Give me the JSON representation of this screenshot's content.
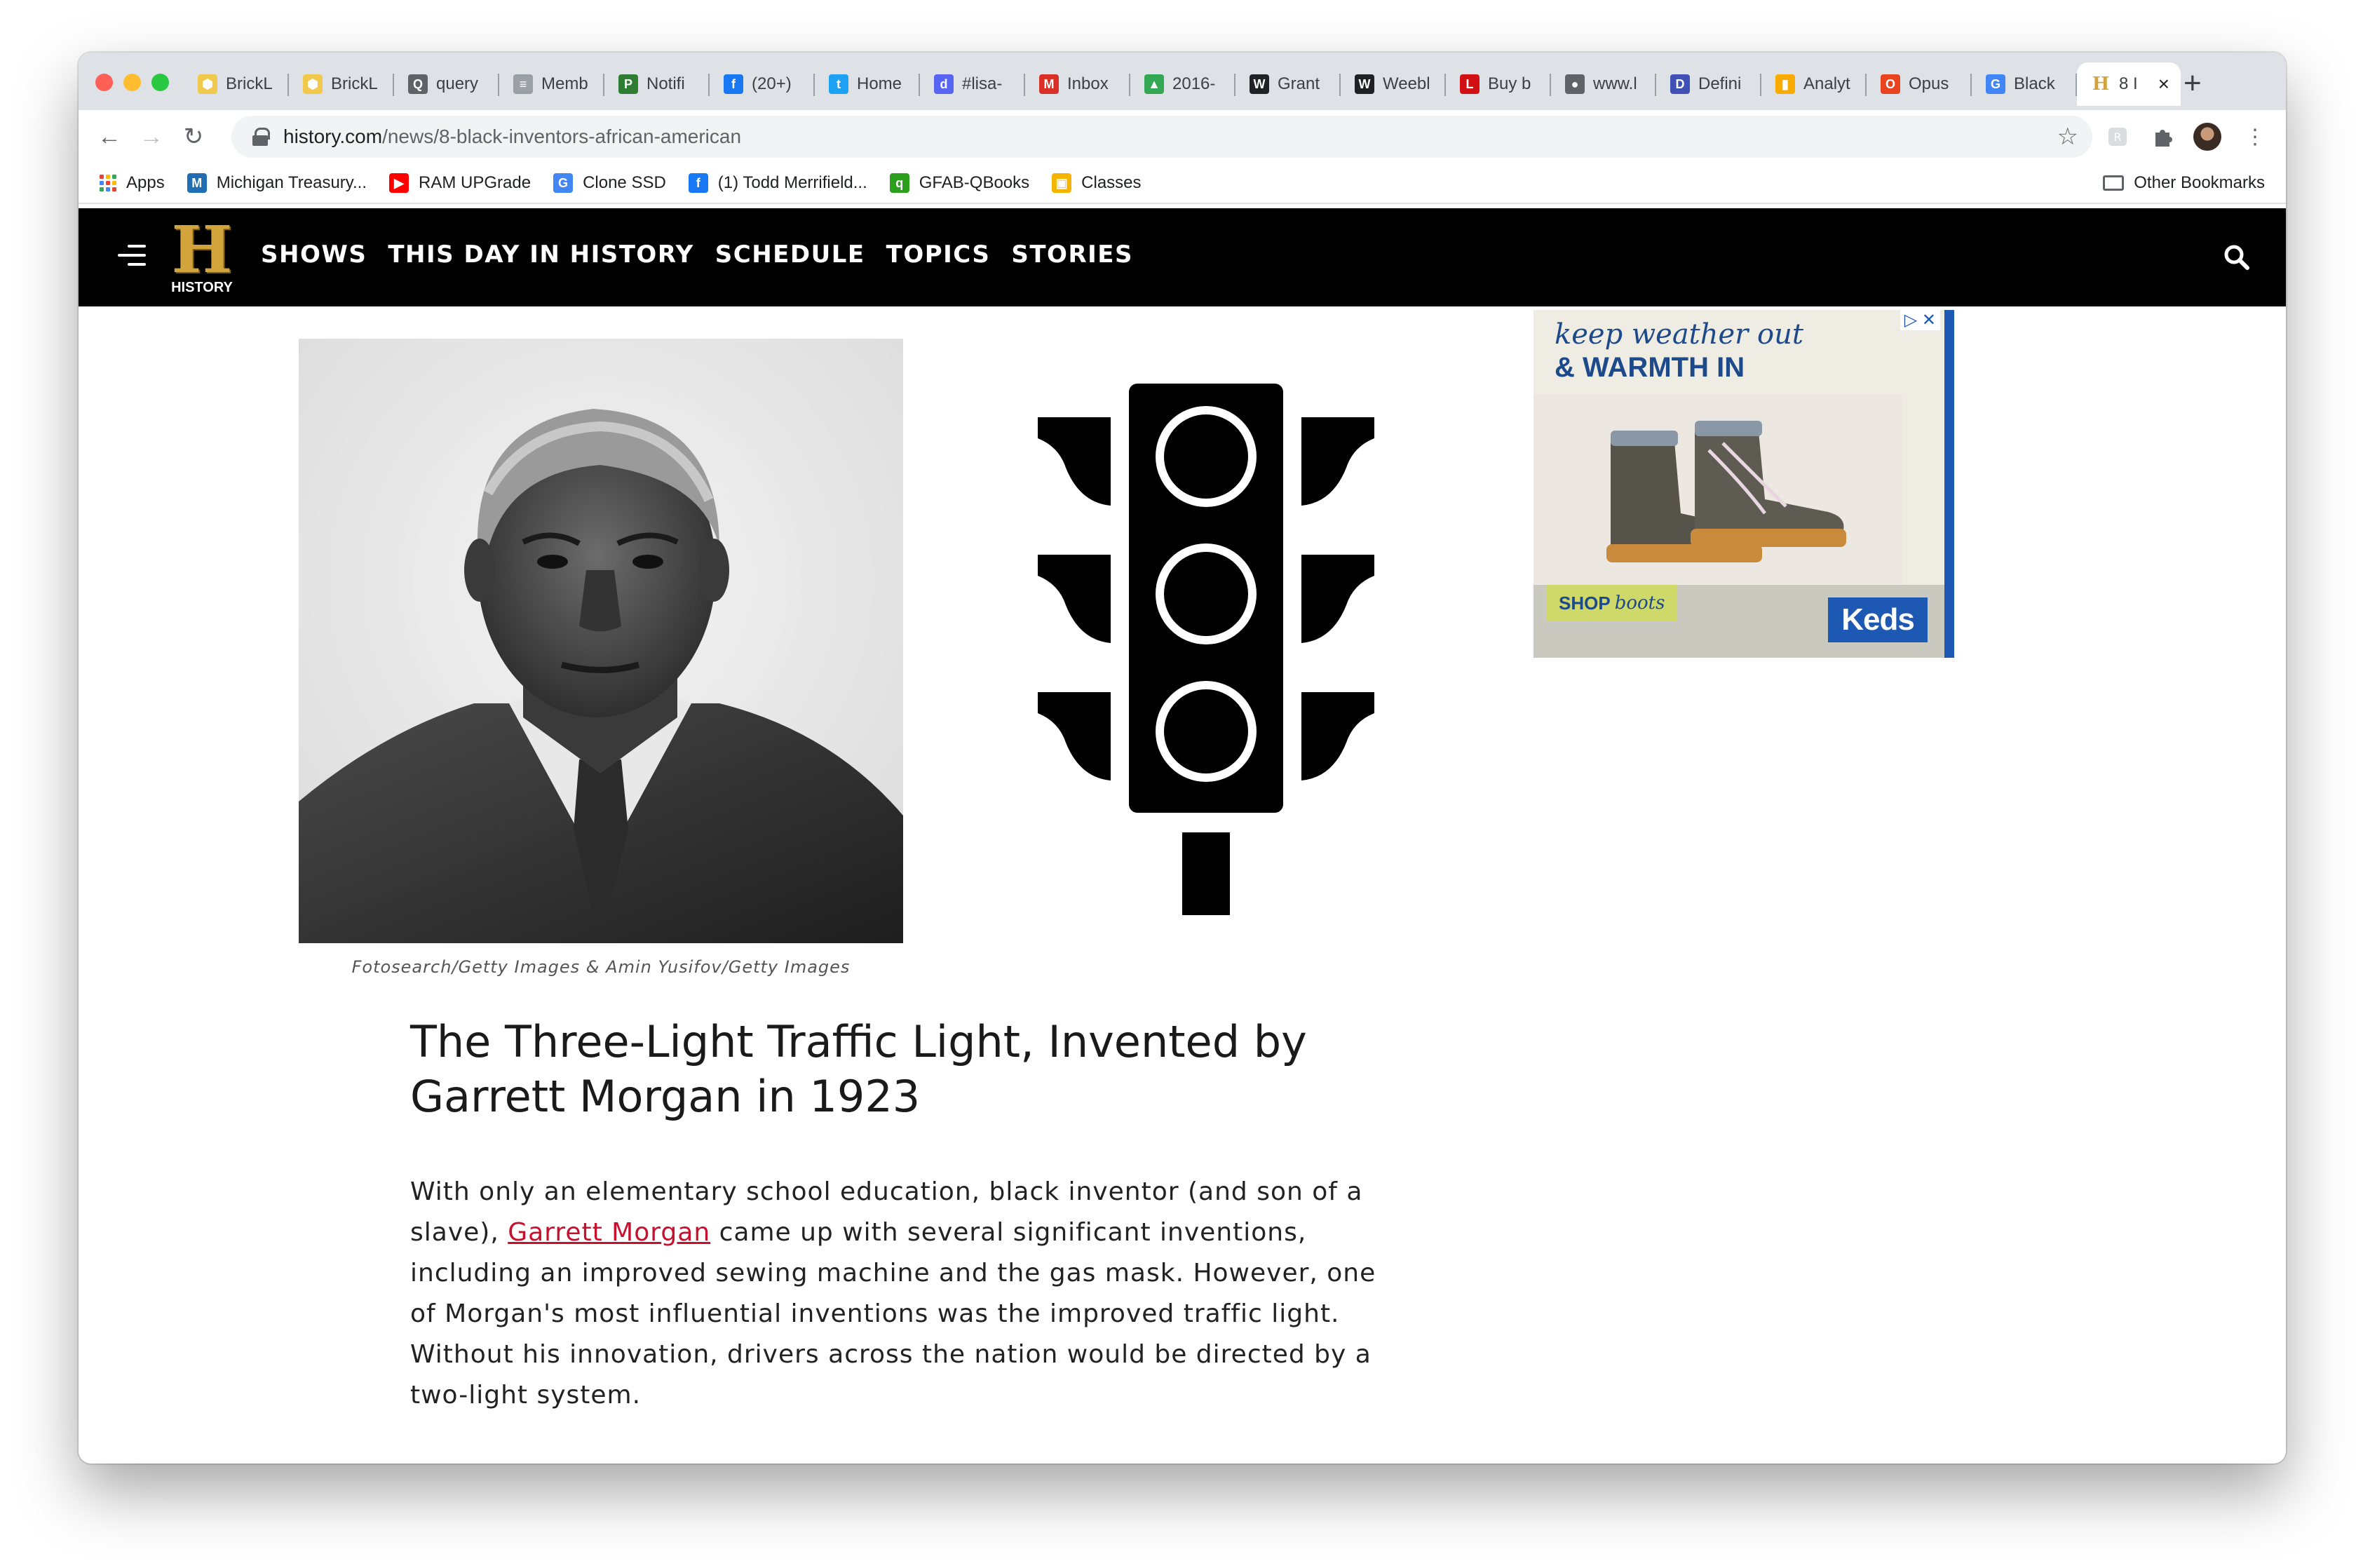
{
  "browser": {
    "tabs": [
      {
        "label": "BrickL",
        "icon": "bricklink-icon",
        "color": "#f2c94c",
        "glyph": "⬢"
      },
      {
        "label": "BrickL",
        "icon": "bricklink-icon",
        "color": "#f2c94c",
        "glyph": "⬢"
      },
      {
        "label": "query",
        "icon": "qt-icon",
        "color": "#5f6368",
        "glyph": "Q"
      },
      {
        "label": "Memb",
        "icon": "member-icon",
        "color": "#9aa0a6",
        "glyph": "≡"
      },
      {
        "label": "Notifi",
        "icon": "notification-icon",
        "color": "#2e7d32",
        "glyph": "P"
      },
      {
        "label": "(20+)",
        "icon": "facebook-icon",
        "color": "#1877f2",
        "glyph": "f"
      },
      {
        "label": "Home",
        "icon": "twitter-icon",
        "color": "#1da1f2",
        "glyph": "t"
      },
      {
        "label": "#lisa-",
        "icon": "discord-icon",
        "color": "#5865f2",
        "glyph": "d"
      },
      {
        "label": "Inbox",
        "icon": "gmail-icon",
        "color": "#d93025",
        "glyph": "M"
      },
      {
        "label": "2016-",
        "icon": "google-drive-icon",
        "color": "#34a853",
        "glyph": "▲"
      },
      {
        "label": "Grant",
        "icon": "weebly-icon",
        "color": "#202124",
        "glyph": "W"
      },
      {
        "label": "Weebl",
        "icon": "weebly-icon",
        "color": "#202124",
        "glyph": "W"
      },
      {
        "label": "Buy b",
        "icon": "lego-icon",
        "color": "#d01012",
        "glyph": "L"
      },
      {
        "label": "www.l",
        "icon": "globe-icon",
        "color": "#5f6368",
        "glyph": "●"
      },
      {
        "label": "Defini",
        "icon": "definition-icon",
        "color": "#3f51b5",
        "glyph": "D"
      },
      {
        "label": "Analyt",
        "icon": "analytics-icon",
        "color": "#f9ab00",
        "glyph": "▮"
      },
      {
        "label": "Opus",
        "icon": "opus-icon",
        "color": "#e8431f",
        "glyph": "O"
      },
      {
        "label": "Black",
        "icon": "google-icon",
        "color": "#4285f4",
        "glyph": "G"
      }
    ],
    "active_tab": {
      "label": "8 I",
      "icon": "history-favicon",
      "glyph": "H",
      "color": "#d4a43c"
    },
    "url_domain": "history.com",
    "url_path": "/news/8-black-inventors-african-american",
    "bookmarks": [
      {
        "label": "Apps",
        "icon": "apps-grid-icon"
      },
      {
        "label": "Michigan Treasury...",
        "icon": "michigan-icon",
        "color": "#1f6fb2",
        "glyph": "M"
      },
      {
        "label": "RAM UPGrade",
        "icon": "youtube-icon",
        "color": "#ff0000",
        "glyph": "▶"
      },
      {
        "label": "Clone SSD",
        "icon": "google-icon",
        "color": "#4285f4",
        "glyph": "G"
      },
      {
        "label": "(1) Todd Merrifield...",
        "icon": "facebook-icon",
        "color": "#1877f2",
        "glyph": "f"
      },
      {
        "label": "GFAB-QBooks",
        "icon": "quickbooks-icon",
        "color": "#2ca01c",
        "glyph": "q"
      },
      {
        "label": "Classes",
        "icon": "classroom-icon",
        "color": "#f4b400",
        "glyph": "▣"
      }
    ],
    "other_bookmarks": "Other Bookmarks"
  },
  "site": {
    "logo_word": "HISTORY",
    "logo_letter": "H",
    "nav": [
      "SHOWS",
      "THIS DAY IN HISTORY",
      "SCHEDULE",
      "TOPICS",
      "STORIES"
    ]
  },
  "article": {
    "caption": "Fotosearch/Getty Images & Amin Yusifov/Getty Images",
    "headline": "The Three-Light Traffic Light, Invented by Garrett Morgan in 1923",
    "body_before": "With only an elementary school education, black inventor (and son of a slave), ",
    "body_link": "Garrett Morgan",
    "body_after": " came up with several significant inventions, including an improved sewing machine and the gas mask. However, one of Morgan's most influential inventions was the improved traffic light. Without his innovation, drivers across the nation would be directed by a two-light system."
  },
  "ad": {
    "headline_line1": "keep weather out",
    "headline_line2": "& WARMTH IN",
    "shop_bold": "SHOP",
    "shop_italic": "boots",
    "brand": "Keds",
    "choices": "▷ ✕"
  }
}
